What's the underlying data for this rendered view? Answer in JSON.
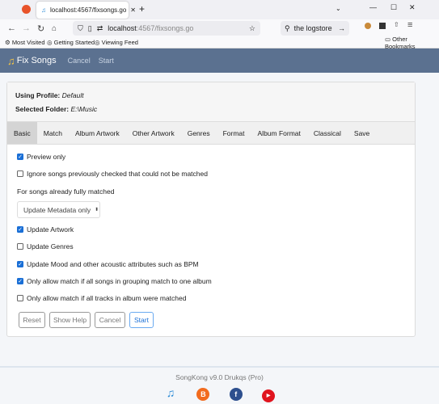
{
  "browser": {
    "tab_title": "localhost:4567/fixsongs.go",
    "url_host": "localhost",
    "url_path": ":4567/fixsongs.go",
    "search_text": "the logstore",
    "bookmarks": [
      "Most Visited",
      "Getting Started",
      "Viewing Feed"
    ],
    "other_bookmarks": "Other Bookmarks"
  },
  "app": {
    "title": "Fix Songs",
    "nav": [
      "Cancel",
      "Start"
    ]
  },
  "profile": {
    "label": "Using Profile:",
    "value": "Default",
    "folder_label": "Selected Folder:",
    "folder_value": "E:\\Music"
  },
  "tabs": [
    "Basic",
    "Match",
    "Album Artwork",
    "Other Artwork",
    "Genres",
    "Format",
    "Album Format",
    "Classical",
    "Save"
  ],
  "options": [
    {
      "label": "Preview only",
      "checked": true
    },
    {
      "label": "Ignore songs previously checked that could not be matched",
      "checked": false
    }
  ],
  "fully_matched_label": "For songs already fully matched",
  "fully_matched_select": "Update Metadata only",
  "options2": [
    {
      "label": "Update Artwork",
      "checked": true
    },
    {
      "label": "Update Genres",
      "checked": false
    },
    {
      "label": "Update Mood and other acoustic attributes such as BPM",
      "checked": true
    },
    {
      "label": "Only allow match if all songs in grouping match to one album",
      "checked": true
    },
    {
      "label": "Only allow match if all tracks in album were matched",
      "checked": false
    }
  ],
  "buttons": {
    "reset": "Reset",
    "help": "Show Help",
    "cancel": "Cancel",
    "start": "Start"
  },
  "footer": {
    "text": "SongKong v9.0 Drukqs (Pro)"
  },
  "colors": {
    "header": "#5b7190",
    "accent": "#1a6fd6"
  }
}
